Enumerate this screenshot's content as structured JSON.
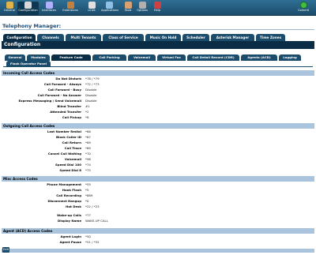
{
  "toolbar": {
    "items": [
      {
        "label": "General",
        "color": "#e0b24a"
      },
      {
        "label": "Configuration",
        "color": "#d9d9d9"
      },
      {
        "label": "Interfaces",
        "color": "#b0b0ff"
      },
      {
        "label": "Extensions",
        "color": "#c08040"
      },
      {
        "label": "Lines",
        "color": "#e0e0e0"
      },
      {
        "label": "Applications",
        "color": "#8fc0e8"
      },
      {
        "label": "Tools",
        "color": "#d9a070"
      },
      {
        "label": "Options",
        "color": "#b0b0b0"
      },
      {
        "label": "Help",
        "color": "#d04040"
      }
    ],
    "commit_label": "Commit"
  },
  "page_title": "Telephony Manager:",
  "main_tabs": [
    "Configuration",
    "Channels",
    "Multi Tenants",
    "Class of Service",
    "Music On Hold",
    "Scheduler",
    "Asterisk Manager",
    "Time Zones"
  ],
  "section_title": "Configuration",
  "sub_tabs": [
    "General",
    "Modules",
    "Feature Code",
    "Call Parking",
    "Voicemail",
    "Virtual Fax",
    "Call Detail Record (CDR)",
    "Agents (ACD)",
    "Logging"
  ],
  "flash_tab": "Flash Operator Panel",
  "sections": [
    {
      "title": "Incoming Call Access Codes",
      "rows": [
        {
          "k": "Do Not Disturb",
          "v": "*78 / *79"
        },
        {
          "k": "Call Forward - Always",
          "v": "*72 / *73"
        },
        {
          "k": "Call Forward - Busy",
          "v": "Disable"
        },
        {
          "k": "Call Forward - No Answer",
          "v": "Disable"
        },
        {
          "k": "Express Messaging / Send Voicemail",
          "v": "Disable"
        },
        {
          "k": "Blind Transfer",
          "v": "#1"
        },
        {
          "k": "Attended Transfer",
          "v": "*2"
        },
        {
          "k": "Call Pickup",
          "v": "*8"
        }
      ]
    },
    {
      "title": "Outgoing Call Access Codes",
      "rows": [
        {
          "k": "Last Number Redial",
          "v": "*66"
        },
        {
          "k": "Block Caller ID",
          "v": "*67"
        },
        {
          "k": "Call Return",
          "v": "*69"
        },
        {
          "k": "Call Trace",
          "v": "*69"
        },
        {
          "k": "Cancel Call Waiting",
          "v": "*70"
        },
        {
          "k": "Voicemail",
          "v": "*98"
        },
        {
          "k": "Speed Dial 100",
          "v": "*74"
        },
        {
          "k": "Speed Dial 8",
          "v": "*75"
        }
      ]
    },
    {
      "title": "Misc Access Codes",
      "rows": [
        {
          "k": "Phone Management",
          "v": "*55"
        },
        {
          "k": "Hook Flash",
          "v": "*5"
        },
        {
          "k": "Call Recording",
          "v": "*889"
        },
        {
          "k": "Disconnect Hangup",
          "v": "*0"
        },
        {
          "k": "Hot Desk",
          "v": "*22 / *23"
        },
        {
          "k": "",
          "v": ""
        },
        {
          "k": "Wake-up Calls",
          "v": "*77"
        },
        {
          "k": "Display Name",
          "v": "WAKE-UP CALL"
        }
      ]
    },
    {
      "title": "Agent (ACD) Access Codes",
      "rows": [
        {
          "k": "Agent Login",
          "v": "*50"
        },
        {
          "k": "Agent Pause",
          "v": "*51 / *52"
        }
      ]
    }
  ],
  "edit_label": "Edit"
}
